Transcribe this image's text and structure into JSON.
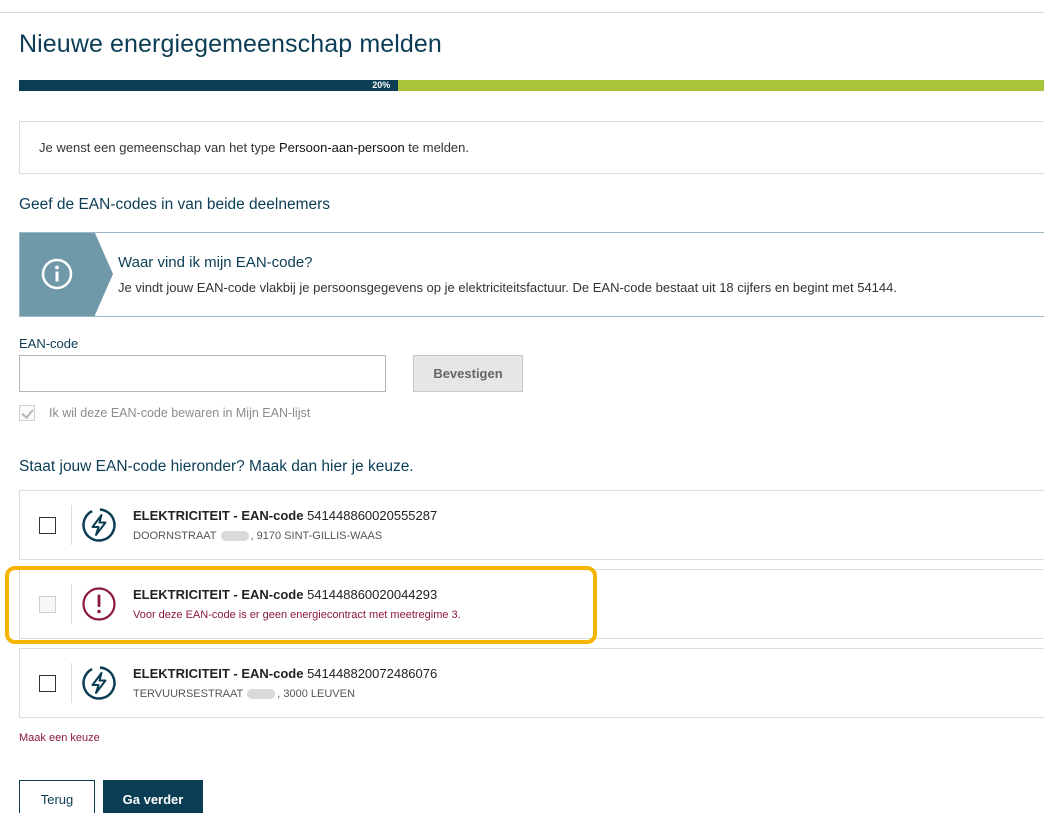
{
  "page": {
    "title": "Nieuwe energiegemeenschap melden",
    "progress": {
      "value_percent": 20,
      "label": "20%"
    }
  },
  "type_notice": {
    "prefix": "Je wenst een gemeenschap van het type ",
    "type_name": "Persoon-aan-persoon",
    "suffix": " te melden."
  },
  "ean_section": {
    "heading": "Geef de EAN-codes in van beide deelnemers",
    "info": {
      "icon": "info-circle-icon",
      "title": "Waar vind ik mijn EAN-code?",
      "text": "Je vindt jouw EAN-code vlakbij je persoonsgegevens op je elektriciteitsfactuur. De EAN-code bestaat uit 18 cijfers en begint met 54144."
    },
    "input_label": "EAN-code",
    "input_value": "",
    "confirm_label": "Bevestigen",
    "save_checkbox_label": "Ik wil deze EAN-code bewaren in Mijn EAN-lijst"
  },
  "list_section": {
    "heading": "Staat jouw EAN-code hieronder? Maak dan hier je keuze.",
    "items": [
      {
        "type_label": "ELEKTRICITEIT - EAN-code",
        "ean": "541448860020555287",
        "street": "DOORNSTRAAT",
        "city": ", 9170 SINT-GILLIS-WAAS",
        "icon": "lightning-icon",
        "disabled": false
      },
      {
        "type_label": "ELEKTRICITEIT - EAN-code",
        "ean": "541448860020044293",
        "error": "Voor deze EAN-code is er geen energiecontract met meetregime 3.",
        "icon": "warning-exclamation-icon",
        "disabled": true
      },
      {
        "type_label": "ELEKTRICITEIT - EAN-code",
        "ean": "541448820072486076",
        "street": "TERVUURSESTRAAT",
        "city": ", 3000 LEUVEN",
        "icon": "lightning-icon",
        "disabled": false
      }
    ],
    "choice_error": "Maak een keuze"
  },
  "footer": {
    "back_label": "Terug",
    "next_label": "Ga verder"
  },
  "colors": {
    "primary": "#0b3d55",
    "progress_remaining": "#a8c53a",
    "info_panel": "#6f98a8",
    "error": "#8b1a38",
    "highlight": "#f5b400"
  }
}
